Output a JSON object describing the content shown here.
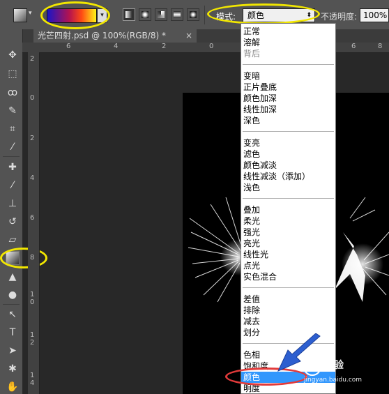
{
  "options_bar": {
    "mode_label": "模式:",
    "mode_value": "颜色",
    "opacity_label": "不透明度:",
    "opacity_value": "100%",
    "gradient_colors": [
      "#1b15c6",
      "#b4134f",
      "#ff4a14",
      "#fff418"
    ],
    "gradient_types": [
      "linear",
      "radial",
      "angle",
      "reflected",
      "diamond"
    ],
    "selected_gradient_type": "linear"
  },
  "document_tab": {
    "title": "光芒四射.psd @ 100%(RGB/8) *",
    "close": "×"
  },
  "ruler": {
    "h_labels": [
      "6",
      "4",
      "2",
      "0",
      "2",
      "4",
      "6",
      "8"
    ],
    "v_labels": [
      "2",
      "0",
      "2",
      "4",
      "6",
      "8",
      "1\n0",
      "1\n2",
      "1\n4"
    ]
  },
  "tools": [
    "move-icon",
    "marquee-icon",
    "lasso-icon",
    "quick-select-icon",
    "crop-icon",
    "eyedropper-icon",
    "healing-icon",
    "brush-icon",
    "stamp-icon",
    "history-brush-icon",
    "eraser-icon",
    "gradient-icon",
    "blur-icon",
    "dodge-icon",
    "pen-icon",
    "type-icon",
    "path-select-icon",
    "shape-icon",
    "hand-icon"
  ],
  "blend_menu": {
    "groups": [
      [
        "正常",
        "溶解",
        "背后"
      ],
      [
        "变暗",
        "正片叠底",
        "颜色加深",
        "线性加深",
        "深色"
      ],
      [
        "变亮",
        "滤色",
        "颜色减淡",
        "线性减淡（添加）",
        "浅色"
      ],
      [
        "叠加",
        "柔光",
        "强光",
        "亮光",
        "线性光",
        "点光",
        "实色混合"
      ],
      [
        "差值",
        "排除",
        "减去",
        "划分"
      ],
      [
        "色相",
        "饱和度",
        "颜色",
        "明度"
      ]
    ],
    "disabled": [
      "背后"
    ],
    "highlighted": "颜色"
  },
  "annotations": {
    "highlight_color": "#f2e700",
    "selection_circle_color": "#e23a3a",
    "arrow_color": "#2d5fd0"
  },
  "watermark": {
    "text": "经验",
    "url": "jingyan.baidu.com"
  }
}
